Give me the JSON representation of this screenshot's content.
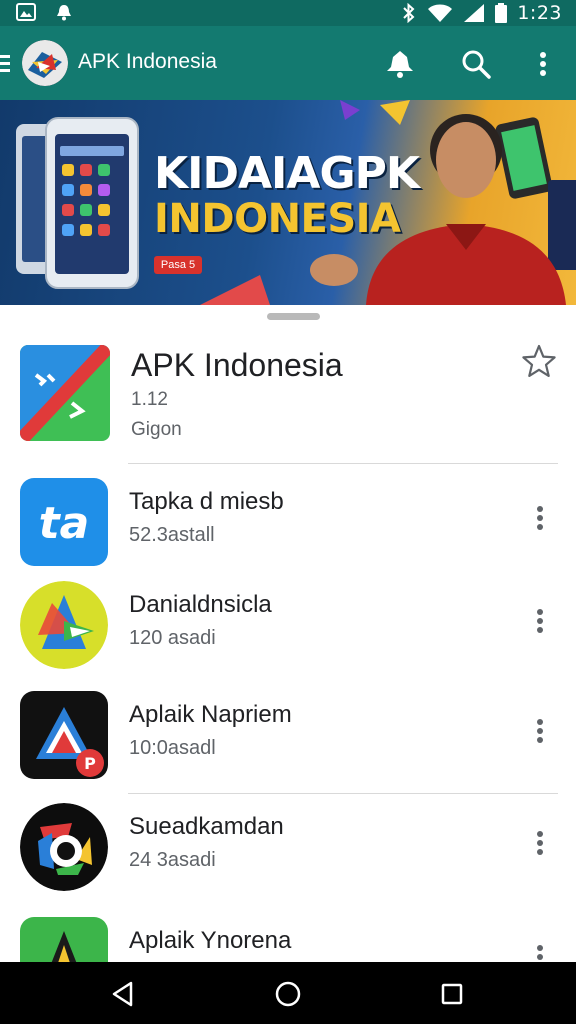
{
  "status_bar": {
    "time": "1:23",
    "icons": [
      "gallery-icon",
      "notification-icon",
      "bluetooth-icon",
      "wifi-icon",
      "signal-icon",
      "battery-icon"
    ]
  },
  "app_bar": {
    "title": "APK Indonesia",
    "actions": [
      "notifications-bell-icon",
      "search-icon",
      "more-vert-icon"
    ]
  },
  "banner": {
    "title_line1": "KIDAIAGPK",
    "title_line2": "INDONESIA",
    "badge": "Pasa 5"
  },
  "featured": {
    "name": "APK Indonesia",
    "version": "1.12",
    "developer": "Gigon"
  },
  "apps": [
    {
      "name": "Tapka d miesb",
      "subtitle": "52.3astall",
      "icon_text": "ta"
    },
    {
      "name": "Danialdnsicla",
      "subtitle": "120 asadi"
    },
    {
      "name": "Aplaik Napriem",
      "subtitle": "10:0asadl"
    },
    {
      "name": "Sueadkamdan",
      "subtitle": "24 3asadi"
    },
    {
      "name": "Aplaik Ynorena",
      "subtitle": ""
    }
  ],
  "colors": {
    "status_bar": "#0f6a61",
    "app_bar": "#137a70",
    "nav_bar": "#000000"
  }
}
